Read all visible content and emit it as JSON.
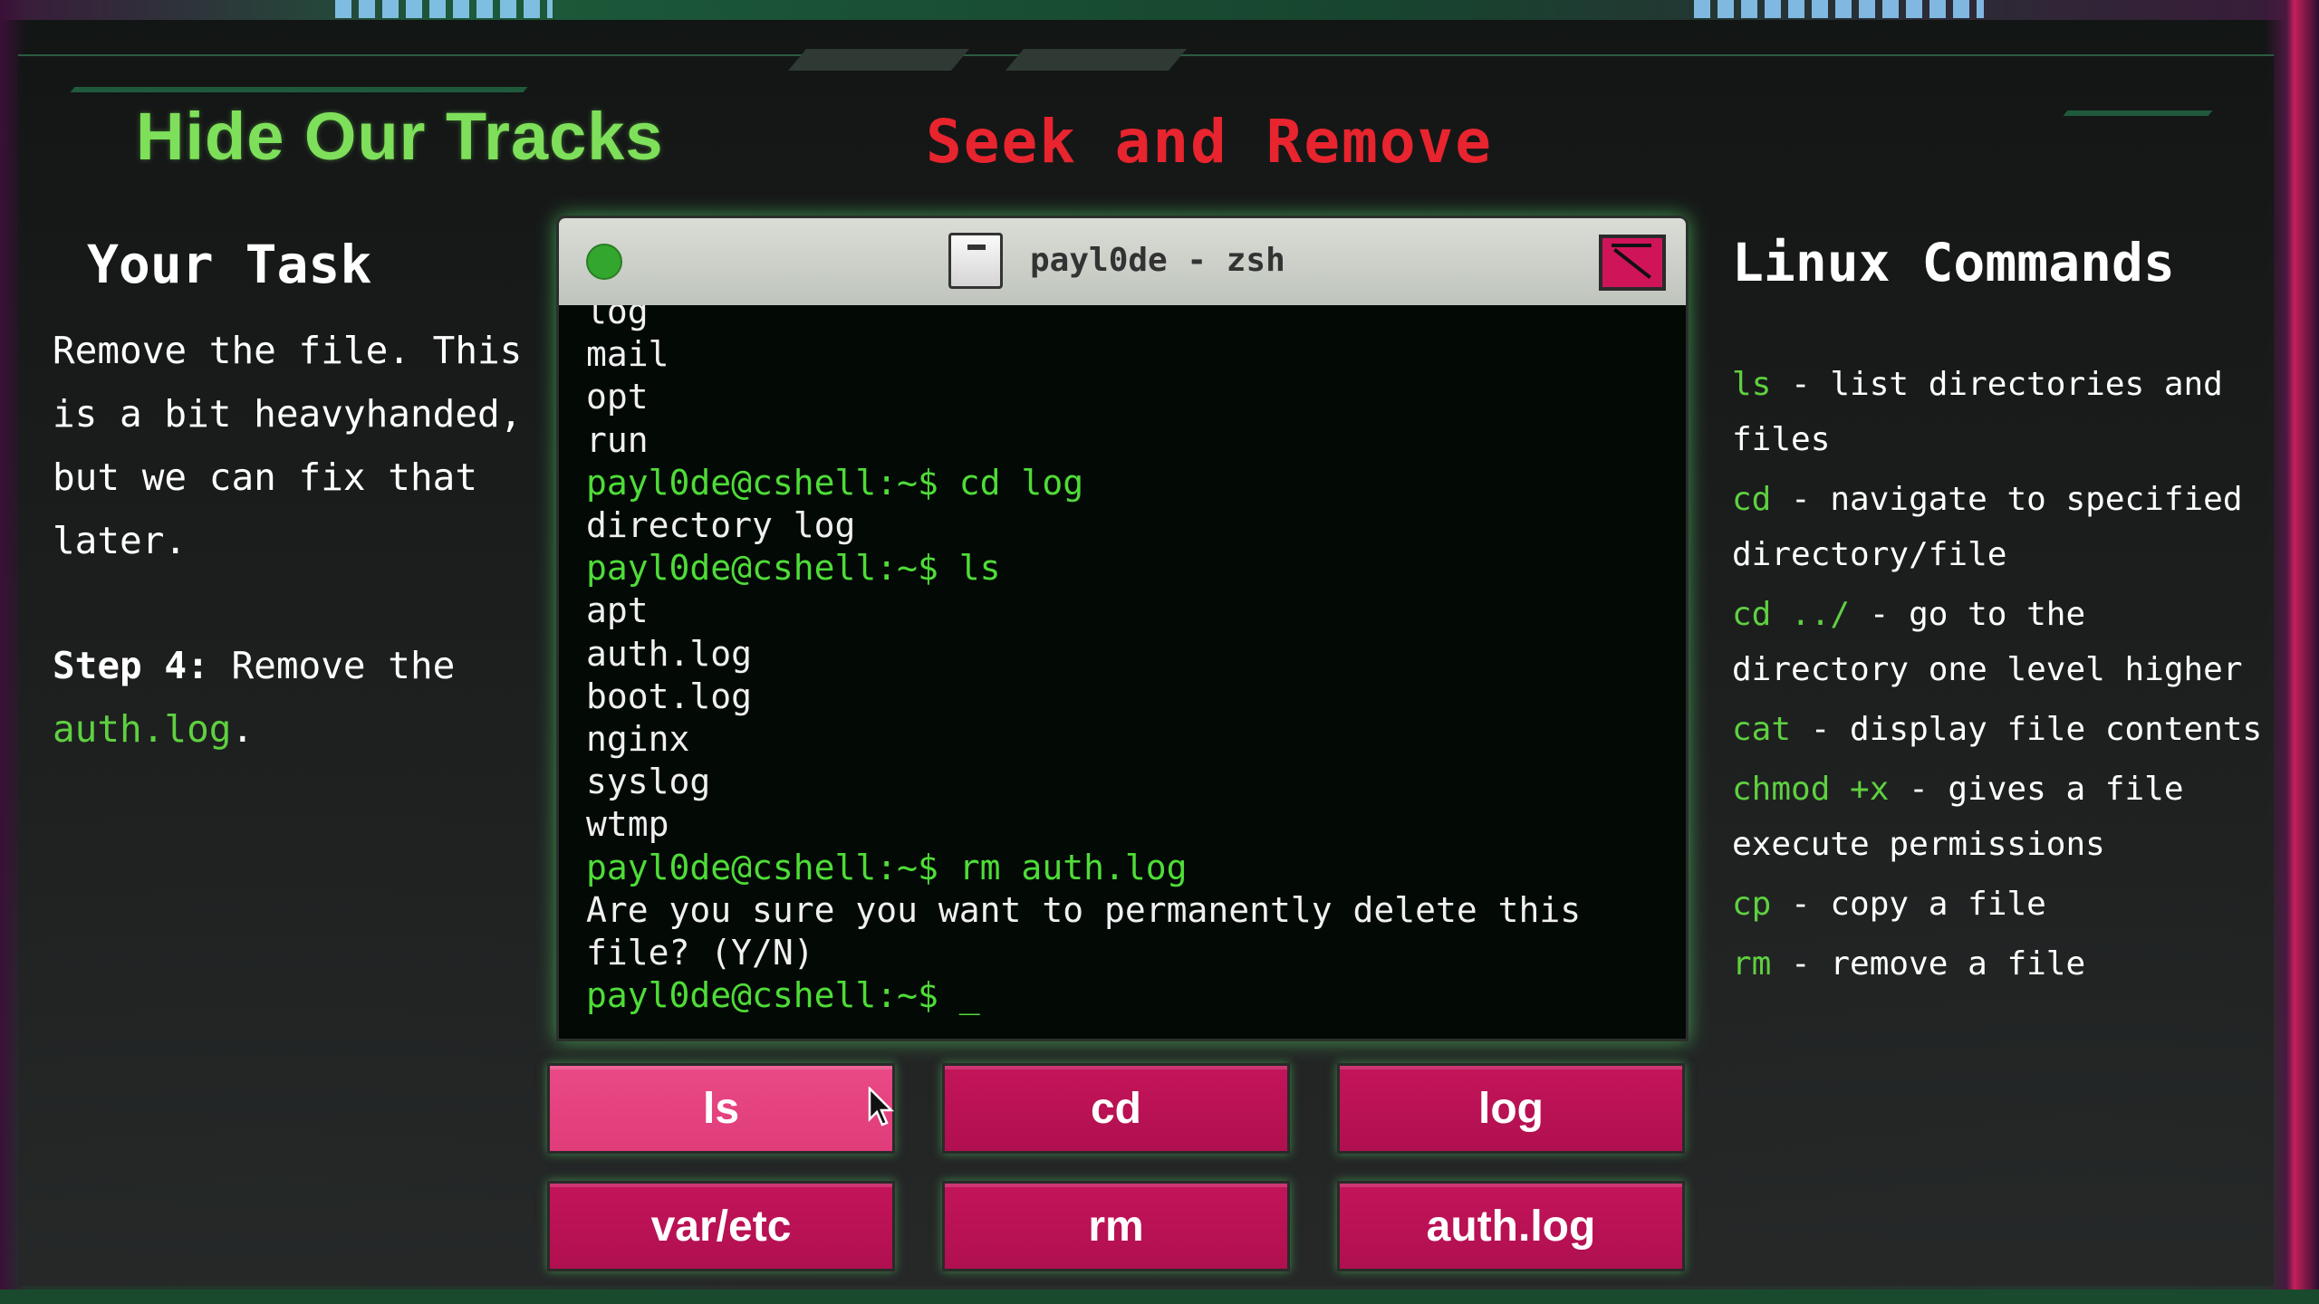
{
  "header": {
    "title": "Hide Our Tracks",
    "subtitle": "Seek and Remove"
  },
  "task": {
    "heading": "Your Task",
    "body": "Remove the file. This is a bit heavyhanded, but we can fix that later.",
    "step_label": "Step 4:",
    "step_text": "Remove the",
    "step_target": "auth.log",
    "step_end": "."
  },
  "terminal": {
    "title": "payl0de - zsh",
    "lines": [
      {
        "kind": "out",
        "text": "log"
      },
      {
        "kind": "out",
        "text": "mail"
      },
      {
        "kind": "out",
        "text": "opt"
      },
      {
        "kind": "out",
        "text": "run"
      },
      {
        "kind": "cmd",
        "text": "payl0de@cshell:~$ cd log"
      },
      {
        "kind": "out",
        "text": "directory log"
      },
      {
        "kind": "cmd",
        "text": "payl0de@cshell:~$ ls"
      },
      {
        "kind": "out",
        "text": "apt"
      },
      {
        "kind": "out",
        "text": "auth.log"
      },
      {
        "kind": "out",
        "text": "boot.log"
      },
      {
        "kind": "out",
        "text": "nginx"
      },
      {
        "kind": "out",
        "text": "syslog"
      },
      {
        "kind": "out",
        "text": "wtmp"
      },
      {
        "kind": "cmd",
        "text": "payl0de@cshell:~$ rm auth.log"
      },
      {
        "kind": "out",
        "text": "Are you sure you want to permanently delete this file? (Y/N)"
      },
      {
        "kind": "cmd",
        "text": "payl0de@cshell:~$ _"
      }
    ]
  },
  "buttons": {
    "ls": "ls",
    "cd": "cd",
    "log": "log",
    "var_etc": "var/etc",
    "rm": "rm",
    "auth_log": "auth.log"
  },
  "commands": {
    "heading": "Linux Commands",
    "items": [
      {
        "cmd": "ls",
        "desc": " - list directories and files"
      },
      {
        "cmd": "cd",
        "desc": " - navigate to specified directory/file"
      },
      {
        "cmd": "cd ../",
        "desc": " - go to the directory one level higher"
      },
      {
        "cmd": "cat",
        "desc": " - display file contents"
      },
      {
        "cmd": "chmod +x",
        "desc": " - gives a file execute permissions"
      },
      {
        "cmd": "cp",
        "desc": " - copy a file"
      },
      {
        "cmd": "rm",
        "desc": " - remove a file"
      }
    ]
  },
  "colors": {
    "title_green": "#7ee05a",
    "subtitle_red": "#e8242e",
    "terminal_green": "#4fdc38",
    "button_pink": "#c4145a",
    "button_hover": "#ea4a86"
  },
  "icons": {
    "status_dot": "green-dot-icon",
    "folder": "folder-icon",
    "close": "close-icon",
    "cursor": "mouse-pointer-icon"
  }
}
